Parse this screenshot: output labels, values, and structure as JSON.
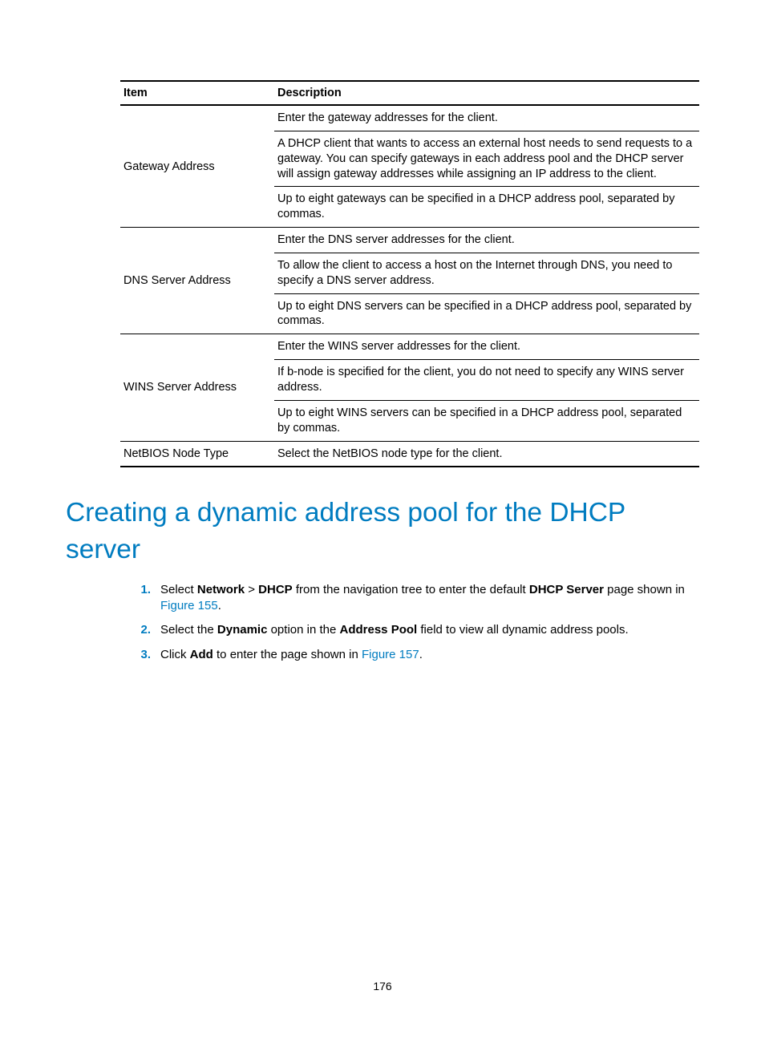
{
  "table": {
    "header_item": "Item",
    "header_desc": "Description",
    "rows": [
      {
        "item": "Gateway Address",
        "desc": [
          "Enter the gateway addresses for the client.",
          "A DHCP client that wants to access an external host needs to send requests to a gateway. You can specify gateways in each address pool and the DHCP server will assign gateway addresses while assigning an IP address to the client.",
          "Up to eight gateways can be specified in a DHCP address pool, separated by commas."
        ]
      },
      {
        "item": "DNS Server Address",
        "desc": [
          "Enter the DNS server addresses for the client.",
          "To allow the client to access a host on the Internet through DNS, you need to specify a DNS server address.",
          "Up to eight DNS servers can be specified in a DHCP address pool, separated by commas."
        ]
      },
      {
        "item": "WINS Server Address",
        "desc": [
          "Enter the WINS server addresses for the client.",
          "If b-node is specified for the client, you do not need to specify any WINS server address.",
          "Up to eight WINS servers can be specified in a DHCP address pool, separated by commas."
        ]
      },
      {
        "item": "NetBIOS Node Type",
        "desc": [
          "Select the NetBIOS node type for the client."
        ]
      }
    ]
  },
  "heading": "Creating a dynamic address pool for the DHCP server",
  "steps": {
    "s1_num": "1.",
    "s1_a": "Select ",
    "s1_network": "Network",
    "s1_gt": " > ",
    "s1_dhcp": "DHCP",
    "s1_b": " from the navigation tree to enter the default ",
    "s1_server": "DHCP Server",
    "s1_c": " page shown in ",
    "s1_link": "Figure 155",
    "s1_d": ".",
    "s2_num": "2.",
    "s2_a": "Select the ",
    "s2_dyn": "Dynamic",
    "s2_b": " option in the ",
    "s2_pool": "Address Pool",
    "s2_c": " field to view all dynamic address pools.",
    "s3_num": "3.",
    "s3_a": "Click ",
    "s3_add": "Add",
    "s3_b": " to enter the page shown in ",
    "s3_link": "Figure 157",
    "s3_c": "."
  },
  "page_number": "176"
}
